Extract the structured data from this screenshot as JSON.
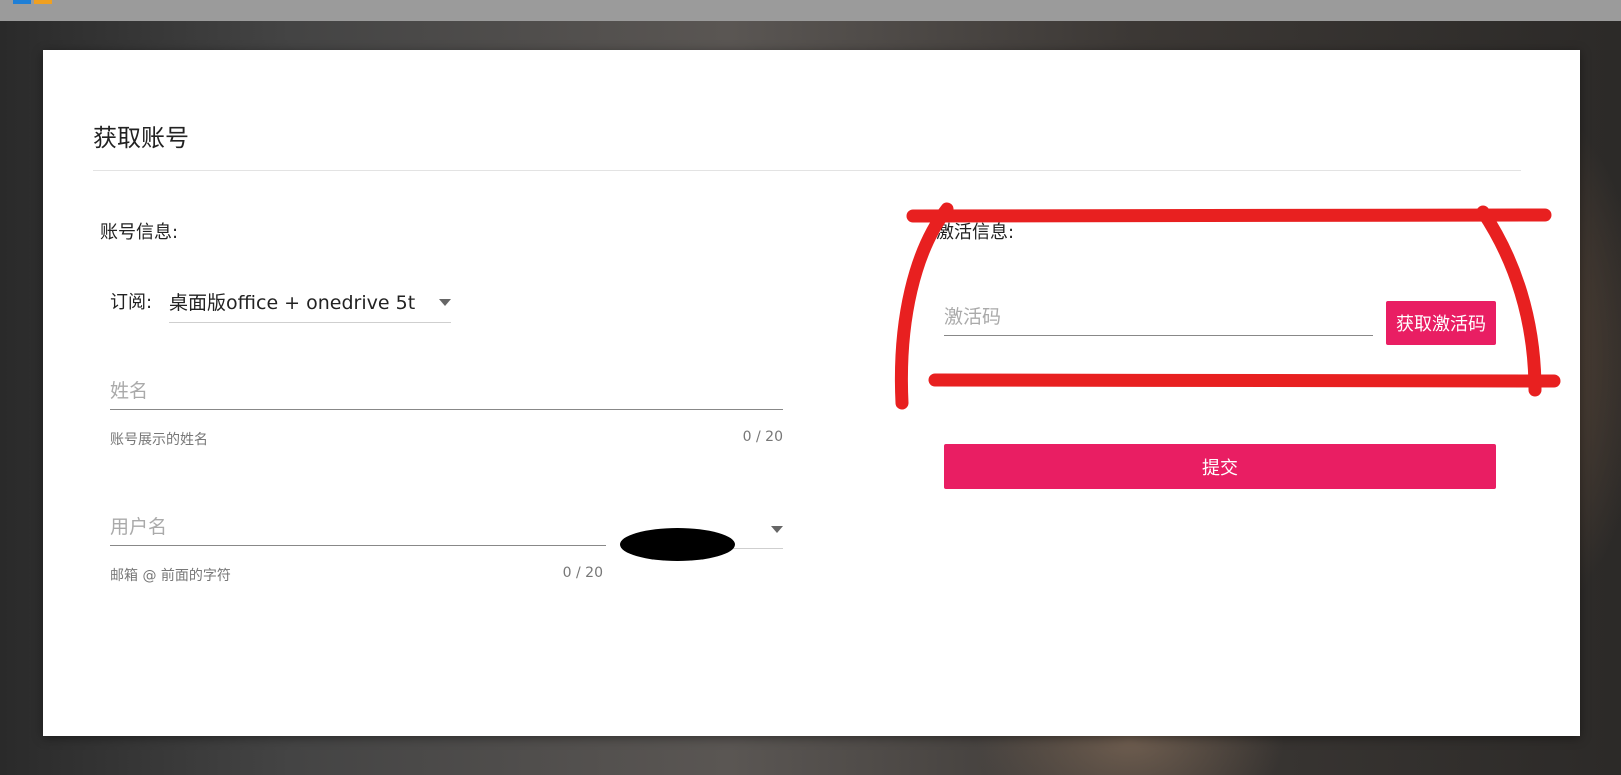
{
  "card": {
    "title": "获取账号"
  },
  "account": {
    "section_label": "账号信息:",
    "subscription": {
      "label": "订阅:",
      "value": "桌面版office + onedrive 5t"
    },
    "name": {
      "placeholder": "姓名",
      "hint": "账号展示的姓名",
      "counter": "0 / 20"
    },
    "username": {
      "placeholder": "用户名",
      "hint": "邮箱 @ 前面的字符",
      "counter": "0 / 20"
    }
  },
  "activation": {
    "section_label": "激活信息:",
    "code": {
      "placeholder": "激活码"
    },
    "get_code_button": "获取激活码",
    "submit_button": "提交"
  },
  "colors": {
    "accent": "#e91e63",
    "annotation": "#e82020",
    "topbar": "#9b9b9b",
    "logo_blue": "#1f7fd6",
    "logo_orange": "#f0a020"
  },
  "icons": [
    "chevron-down-icon",
    "logo-icon"
  ]
}
